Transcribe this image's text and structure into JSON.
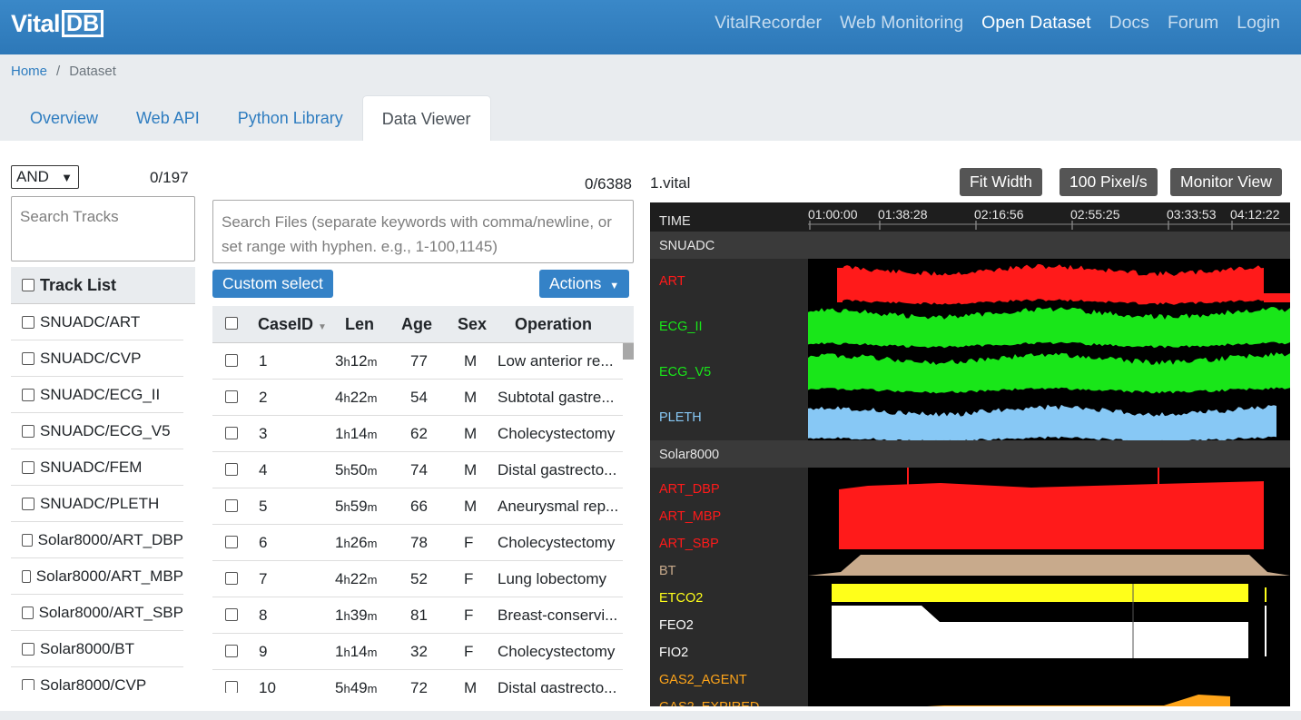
{
  "header": {
    "logo_vital": "Vital",
    "logo_db": "DB",
    "nav": [
      {
        "label": "VitalRecorder",
        "active": false
      },
      {
        "label": "Web Monitoring",
        "active": false
      },
      {
        "label": "Open Dataset",
        "active": true
      },
      {
        "label": "Docs",
        "active": false
      },
      {
        "label": "Forum",
        "active": false
      },
      {
        "label": "Login",
        "active": false
      }
    ]
  },
  "breadcrumb": {
    "home": "Home",
    "separator": "/",
    "current": "Dataset"
  },
  "tabs": [
    "Overview",
    "Web API",
    "Python Library",
    "Data Viewer"
  ],
  "tracks": {
    "operator": "AND",
    "count": "0/197",
    "search_placeholder": "Search Tracks",
    "header": "Track List",
    "items": [
      "SNUADC/ART",
      "SNUADC/CVP",
      "SNUADC/ECG_II",
      "SNUADC/ECG_V5",
      "SNUADC/FEM",
      "SNUADC/PLETH",
      "Solar8000/ART_DBP",
      "Solar8000/ART_MBP",
      "Solar8000/ART_SBP",
      "Solar8000/BT",
      "Solar8000/CVP"
    ]
  },
  "files": {
    "count": "0/6388",
    "search_placeholder": "Search Files (separate keywords with comma/newline, or set range with hyphen. e.g., 1-100,1145)",
    "custom_select": "Custom select",
    "actions": "Actions",
    "columns": [
      "CaseID",
      "Len",
      "Age",
      "Sex",
      "Operation"
    ],
    "rows": [
      {
        "id": "1",
        "h": "3",
        "m": "12",
        "age": "77",
        "sex": "M",
        "op": "Low anterior re..."
      },
      {
        "id": "2",
        "h": "4",
        "m": "22",
        "age": "54",
        "sex": "M",
        "op": "Subtotal gastre..."
      },
      {
        "id": "3",
        "h": "1",
        "m": "14",
        "age": "62",
        "sex": "M",
        "op": "Cholecystectomy"
      },
      {
        "id": "4",
        "h": "5",
        "m": "50",
        "age": "74",
        "sex": "M",
        "op": "Distal gastrecto..."
      },
      {
        "id": "5",
        "h": "5",
        "m": "59",
        "age": "66",
        "sex": "M",
        "op": "Aneurysmal rep..."
      },
      {
        "id": "6",
        "h": "1",
        "m": "26",
        "age": "78",
        "sex": "F",
        "op": "Cholecystectomy"
      },
      {
        "id": "7",
        "h": "4",
        "m": "22",
        "age": "52",
        "sex": "F",
        "op": "Lung lobectomy"
      },
      {
        "id": "8",
        "h": "1",
        "m": "39",
        "age": "81",
        "sex": "F",
        "op": "Breast-conservi..."
      },
      {
        "id": "9",
        "h": "1",
        "m": "14",
        "age": "32",
        "sex": "F",
        "op": "Cholecystectomy"
      },
      {
        "id": "10",
        "h": "5",
        "m": "49",
        "age": "72",
        "sex": "M",
        "op": "Distal gastrecto..."
      }
    ]
  },
  "viewer": {
    "file_name": "1.vital",
    "buttons": [
      "Fit Width",
      "100 Pixel/s",
      "Monitor View"
    ],
    "time_label": "TIME",
    "time_ticks": [
      "01:00:00",
      "01:38:28",
      "02:16:56",
      "02:55:25",
      "03:33:53",
      "04:12:22"
    ],
    "groups": [
      {
        "name": "SNUADC",
        "tracks": [
          {
            "label": "ART",
            "color": "#ff1a1a"
          },
          {
            "label": "ECG_II",
            "color": "#19e619"
          },
          {
            "label": "ECG_V5",
            "color": "#19e619"
          },
          {
            "label": "PLETH",
            "color": "#87c8f5"
          }
        ]
      },
      {
        "name": "Solar8000",
        "tracks": [
          {
            "label": "ART_DBP",
            "color": "#ff1a1a"
          },
          {
            "label": "ART_MBP",
            "color": "#ff1a1a"
          },
          {
            "label": "ART_SBP",
            "color": "#ff1a1a"
          },
          {
            "label": "BT",
            "color": "#c8aa8c"
          },
          {
            "label": "ETCO2",
            "color": "#ffff1a"
          },
          {
            "label": "FEO2",
            "color": "#ffffff"
          },
          {
            "label": "FIO2",
            "color": "#ffffff"
          },
          {
            "label": "GAS2_AGENT",
            "color": "#ffa51a"
          },
          {
            "label": "GAS2_EXPIRED",
            "color": "#ffa51a"
          }
        ]
      }
    ]
  }
}
